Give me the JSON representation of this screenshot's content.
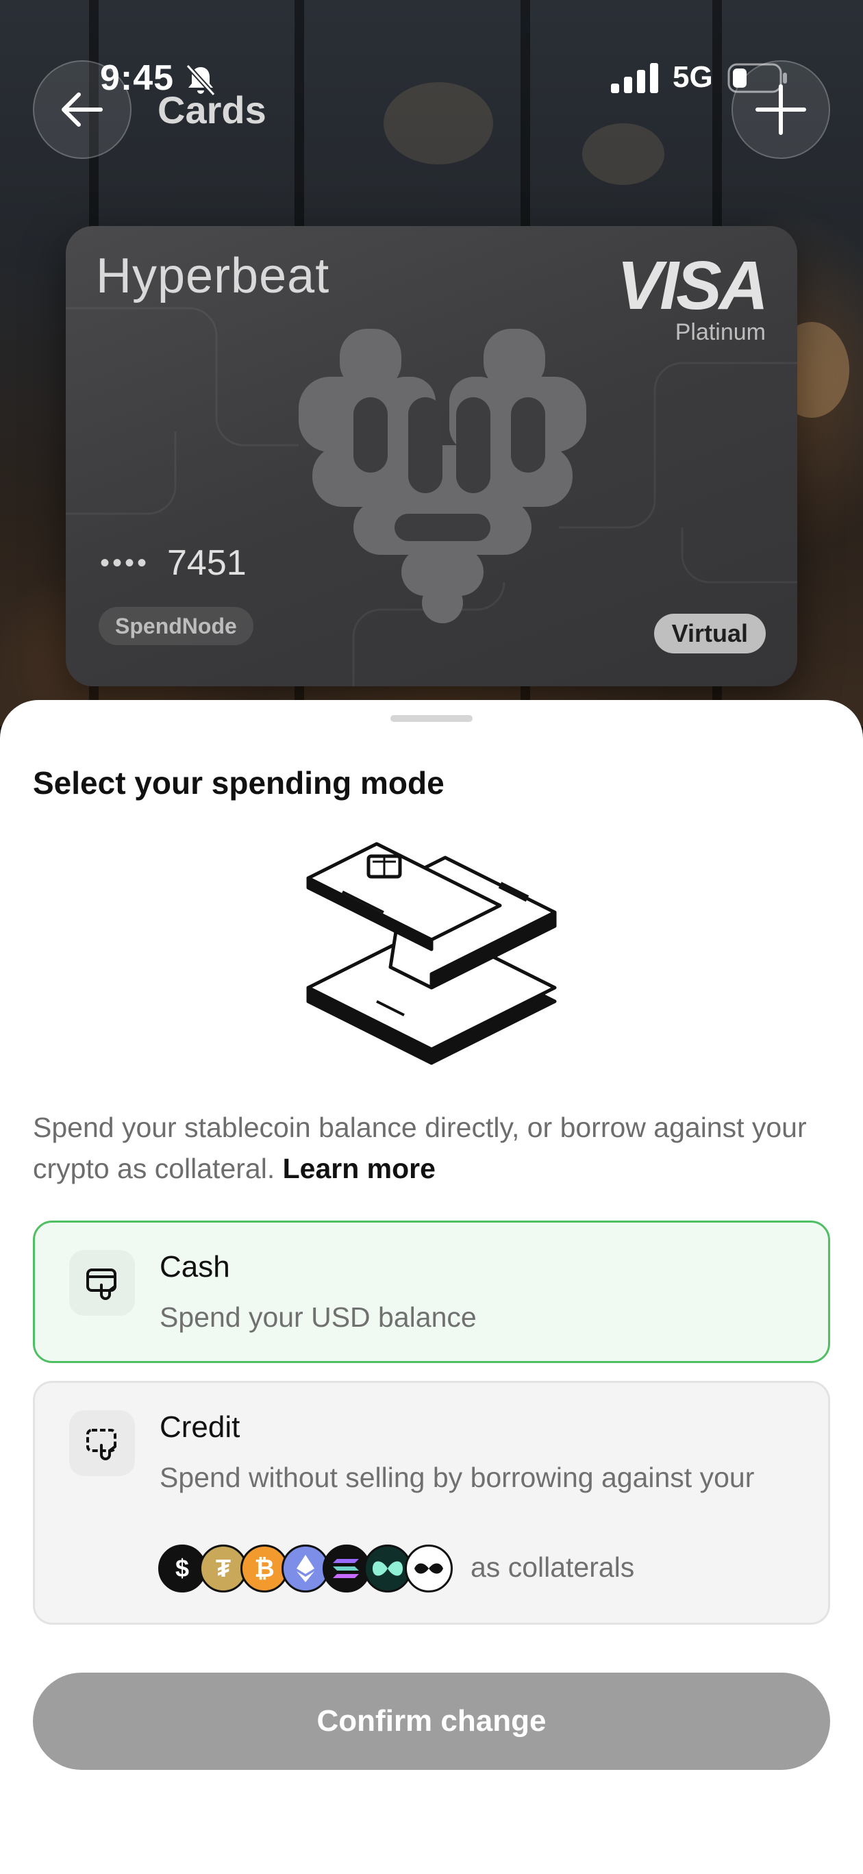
{
  "status_bar": {
    "time": "9:45",
    "network": "5G",
    "icons": [
      "bell-slash-icon",
      "cellular-signal-icon",
      "battery-icon"
    ]
  },
  "nav": {
    "title": "Cards",
    "back_icon": "arrow-left-icon",
    "add_icon": "plus-icon"
  },
  "card": {
    "brand": "Hyperbeat",
    "network": "VISA",
    "tier": "Platinum",
    "masked_dots": "••••",
    "last4": "7451",
    "issuer": "SpendNode",
    "type": "Virtual"
  },
  "sheet": {
    "title": "Select your spending mode",
    "description": "Spend your stablecoin balance directly, or borrow against your crypto as collateral.",
    "learn_more": "Learn more",
    "options": [
      {
        "title": "Cash",
        "subtitle": "Spend your USD balance",
        "icon": "cash-card-icon",
        "selected": true
      },
      {
        "title": "Credit",
        "subtitle": "Spend without selling by borrowing against your",
        "icon": "credit-card-icon",
        "selected": false,
        "collateral_suffix": "as collaterals",
        "collateral_icons": [
          "usd-coin-icon",
          "tether-coin-icon",
          "bitcoin-icon",
          "ethereum-icon",
          "solana-icon",
          "hyperliquid-icon",
          "meme-coin-icon"
        ]
      }
    ],
    "confirm_label": "Confirm change"
  },
  "colors": {
    "selected_border": "#4fbf64",
    "selected_bg": "#f0faf2",
    "button_disabled": "#9e9e9e"
  }
}
